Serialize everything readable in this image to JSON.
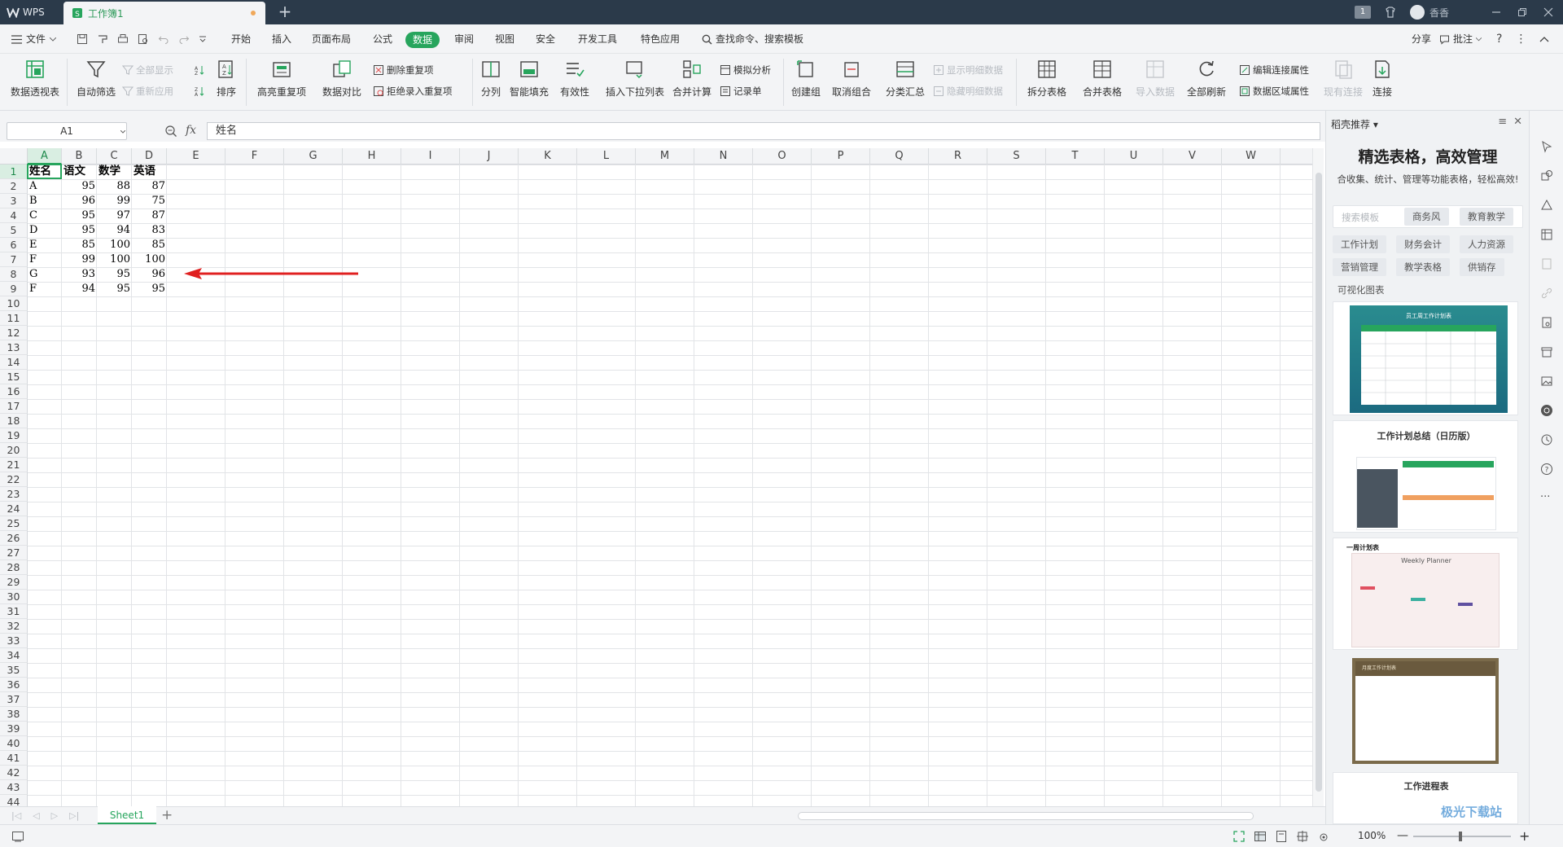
{
  "titlebar": {
    "app_name": "WPS",
    "doc_tab": "工作簿1",
    "user_name": "香香",
    "page_badge": "1"
  },
  "menu": {
    "file": "文件",
    "items": [
      "开始",
      "插入",
      "页面布局",
      "公式",
      "数据",
      "审阅",
      "视图",
      "安全",
      "开发工具",
      "特色应用"
    ],
    "active": "数据",
    "search": "查找命令、搜索模板",
    "share": "分享",
    "comment": "批注"
  },
  "ribbon": {
    "pivot": "数据透视表",
    "autofilter": "自动筛选",
    "show_all": "全部显示",
    "reapply": "重新应用",
    "sort": "排序",
    "highlight_dup": "高亮重复项",
    "compare": "数据对比",
    "remove_dup": "删除重复项",
    "reject_dup": "拒绝录入重复项",
    "split_col": "分列",
    "smart_fill": "智能填充",
    "validity": "有效性",
    "insert_dropdown": "插入下拉列表",
    "consolidate": "合并计算",
    "what_if": "模拟分析",
    "record_form": "记录单",
    "group": "创建组",
    "ungroup": "取消组合",
    "subtotal": "分类汇总",
    "show_detail": "显示明细数据",
    "hide_detail": "隐藏明细数据",
    "split_table": "拆分表格",
    "merge_table": "合并表格",
    "import_data": "导入数据",
    "refresh_all": "全部刷新",
    "edit_conn": "编辑连接属性",
    "data_region": "数据区域属性",
    "existing_conn": "现有连接",
    "connect": "连接"
  },
  "formula": {
    "name_box": "A1",
    "fx": "fx",
    "content": "姓名"
  },
  "sheet": {
    "columns": [
      "A",
      "B",
      "C",
      "D",
      "E",
      "F",
      "G",
      "H",
      "I",
      "J",
      "K",
      "L",
      "M",
      "N",
      "O",
      "P",
      "Q",
      "R",
      "S",
      "T",
      "U",
      "V",
      "W"
    ],
    "header_row": [
      "姓名",
      "语文",
      "数学",
      "英语"
    ],
    "rows": [
      [
        "A",
        "95",
        "88",
        "87"
      ],
      [
        "B",
        "96",
        "99",
        "75"
      ],
      [
        "C",
        "95",
        "97",
        "87"
      ],
      [
        "D",
        "95",
        "94",
        "83"
      ],
      [
        "E",
        "85",
        "100",
        "85"
      ],
      [
        "F",
        "99",
        "100",
        "100"
      ],
      [
        "G",
        "93",
        "95",
        "96"
      ],
      [
        "F",
        "94",
        "95",
        "95"
      ]
    ],
    "row_count": 44,
    "tab_name": "Sheet1",
    "arrow_color": "#e02020"
  },
  "status": {
    "zoom": "100%"
  },
  "sidepanel": {
    "title": "稻壳推荐",
    "headline": "精选表格，高效管理",
    "subline": "合收集、统计、管理等功能表格，轻松高效!",
    "search_placeholder": "搜索模板",
    "chips_top": [
      "商务风",
      "教育教学"
    ],
    "chips": [
      "工作计划",
      "财务会计",
      "人力资源",
      "营销管理",
      "教学表格",
      "供销存"
    ],
    "section": "可视化图表",
    "templates": [
      "员工周工作计划表",
      "工作计划总结（日历版）",
      "一周计划表",
      "月度工作计划表",
      "工作进程表"
    ],
    "planner_caption": "Weekly Planner"
  },
  "watermark": "极光下载站"
}
